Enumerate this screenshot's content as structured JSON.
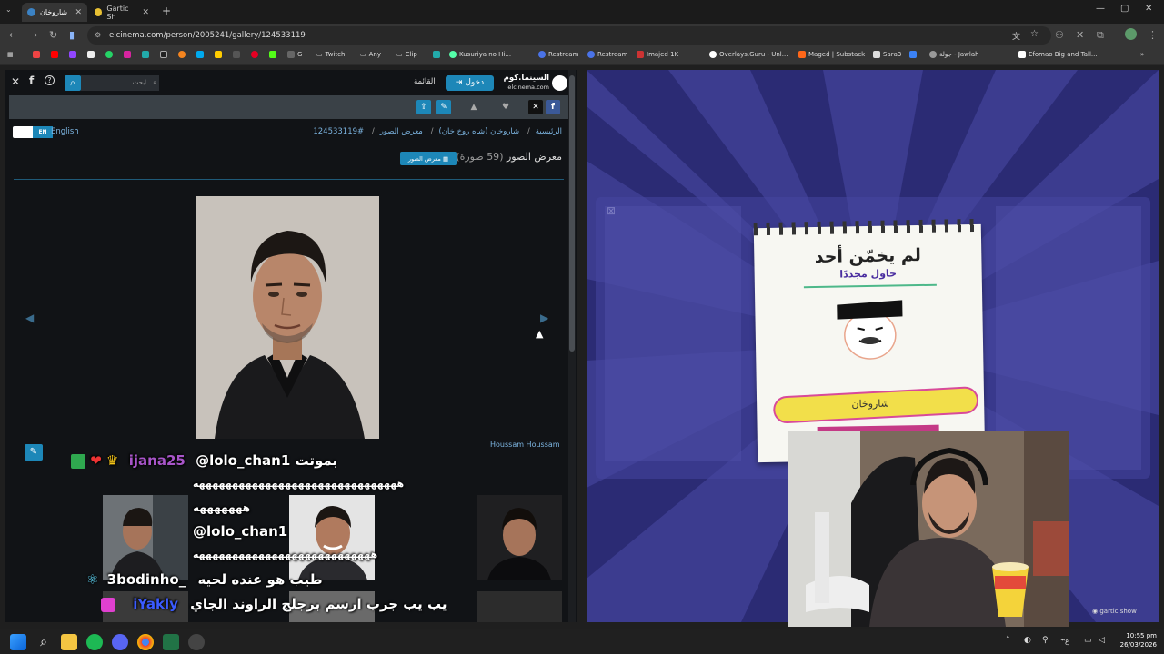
{
  "browser": {
    "tabs": [
      {
        "title": "شاروخان",
        "active": true
      },
      {
        "title": "Gartic Sh",
        "active": false
      }
    ],
    "url": "elcinema.com/person/2005241/gallery/124533119",
    "bookmarks": [
      "Twitch",
      "Any",
      "Clip",
      "Kusuriya no Hi...",
      "Restream",
      "Restream",
      "Imajed 1K",
      "Overlays.Guru - Unl...",
      "Maged | Substack",
      "Sara3",
      "جولة - Jawlah",
      "Efomao Big and Tall..."
    ]
  },
  "site": {
    "logo_ar": "السينما.كوم",
    "logo_en": "elcinema.com",
    "login_label": "دخول",
    "menu_label": "القائمة",
    "search_placeholder": "ابحث",
    "lang_toggle": "EN",
    "lang_label": "English",
    "breadcrumb": {
      "home": "الرئيسية",
      "person": "شاروخان (شاه روخ خان)",
      "gallery": "معرض الصور",
      "id": "#124533119"
    },
    "gallery_title": "معرض الصور",
    "gallery_count": "(59 صورة)",
    "gallery_button": "معرض الصور",
    "uploader": "Houssam Houssam"
  },
  "chat": [
    {
      "user": "ijana25",
      "text": "@lolo_chan1 بموتت",
      "color": "#a855c9"
    },
    {
      "user": "",
      "text": "هههههههههههههههههههههههههههههههه",
      "color": "#fff"
    },
    {
      "user": "",
      "text": "هههههههه",
      "color": "#fff"
    },
    {
      "user": "",
      "text": "@lolo_chan1",
      "color": "#fff"
    },
    {
      "user": "",
      "text": "هههههههههههههههههههههههههههه",
      "color": "#fff"
    },
    {
      "user": "3bodinho_",
      "text": "طيب هو عنده لحيه",
      "color": "#ffffff"
    },
    {
      "user": "iYakly",
      "text": "يب يب جرب ارسم برجلج الراوند الجاي",
      "color": "#3b5bff"
    }
  ],
  "gartic": {
    "card_title": "لم يخمّن أحد",
    "card_subtitle": "حاول مجددًا",
    "answer": "شاروخان",
    "watermark": "gartic.show"
  },
  "taskbar": {
    "time": "10:55 pm",
    "date": "26/03/2026",
    "lang": "ع"
  }
}
